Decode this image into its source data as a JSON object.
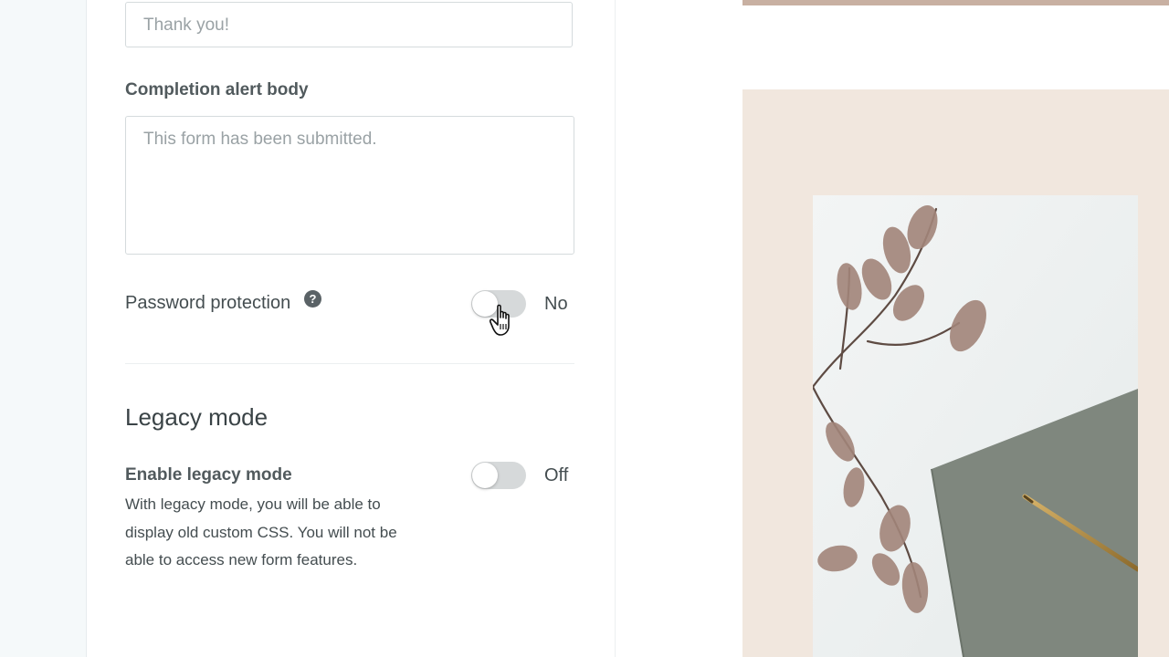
{
  "completion": {
    "title_value": "Thank you!",
    "body_label": "Completion alert body",
    "body_placeholder": "This form has been submitted."
  },
  "password": {
    "label": "Password protection",
    "help_icon": "question-mark-icon",
    "state": "No"
  },
  "legacy": {
    "heading": "Legacy mode",
    "label": "Enable legacy mode",
    "state": "Off",
    "description": "With legacy mode, you will be able to display old custom CSS. You will not be able to access new form features."
  },
  "colors": {
    "preview_background": "#f1e7de",
    "preview_topbar": "#c8b0a2",
    "notebook": "#7f877e"
  }
}
